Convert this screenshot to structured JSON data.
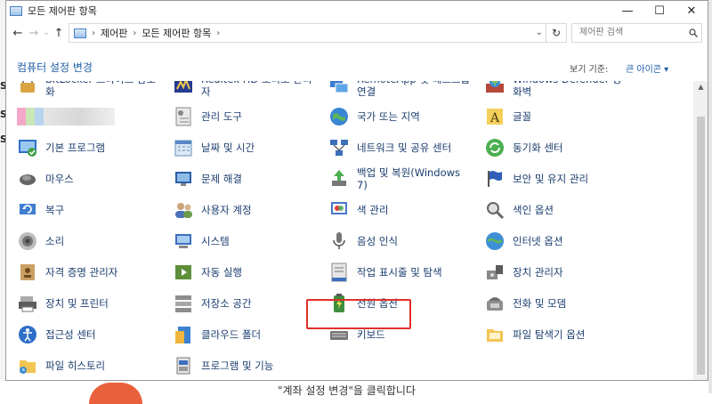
{
  "window": {
    "title": "모든 제어판 항목",
    "controls": {
      "minimize": "—",
      "maximize": "☐",
      "close": "✕"
    }
  },
  "address": {
    "path": [
      "제어판",
      "모든 제어판 항목"
    ],
    "search_placeholder": "제어판 검색"
  },
  "header": {
    "title": "컴퓨터 설정 변경",
    "view_by_label": "보기 기준:",
    "view_by_value": "큰 아이콘 ▾"
  },
  "background": {
    "left_glyphs": [
      "S",
      "S",
      "S"
    ],
    "bottom_text": "\"계좌 설정 변경\"을 클릭합니다"
  },
  "items": [
    {
      "label": "BitLocker 드라이브 암호화",
      "icon": "bitlocker-icon"
    },
    {
      "label": "Realtek HD 오디오 관리자",
      "icon": "realtek-audio-icon"
    },
    {
      "label": "RemoteApp 및 데스크톱 연결",
      "icon": "remoteapp-icon"
    },
    {
      "label": "Windows Defender 방화벽",
      "icon": "firewall-icon"
    },
    {
      "label": "",
      "icon": "blurred-item-icon"
    },
    {
      "label": "관리 도구",
      "icon": "admin-tools-icon"
    },
    {
      "label": "국가 또는 지역",
      "icon": "region-icon"
    },
    {
      "label": "글꼴",
      "icon": "fonts-icon"
    },
    {
      "label": "기본 프로그램",
      "icon": "default-programs-icon"
    },
    {
      "label": "날짜 및 시간",
      "icon": "date-time-icon"
    },
    {
      "label": "네트워크 및 공유 센터",
      "icon": "network-icon"
    },
    {
      "label": "동기화 센터",
      "icon": "sync-center-icon"
    },
    {
      "label": "마우스",
      "icon": "mouse-icon"
    },
    {
      "label": "문제 해결",
      "icon": "troubleshoot-icon"
    },
    {
      "label": "백업 및 복원(Windows 7)",
      "icon": "backup-icon"
    },
    {
      "label": "보안 및 유지 관리",
      "icon": "security-flag-icon"
    },
    {
      "label": "복구",
      "icon": "recovery-icon"
    },
    {
      "label": "사용자 계정",
      "icon": "user-accounts-icon"
    },
    {
      "label": "색 관리",
      "icon": "color-management-icon"
    },
    {
      "label": "색인 옵션",
      "icon": "indexing-icon"
    },
    {
      "label": "소리",
      "icon": "sound-icon"
    },
    {
      "label": "시스템",
      "icon": "system-icon"
    },
    {
      "label": "음성 인식",
      "icon": "speech-icon"
    },
    {
      "label": "인터넷 옵션",
      "icon": "internet-options-icon"
    },
    {
      "label": "자격 증명 관리자",
      "icon": "credential-icon"
    },
    {
      "label": "자동 실행",
      "icon": "autoplay-icon"
    },
    {
      "label": "작업 표시줄 및 탐색",
      "icon": "taskbar-icon"
    },
    {
      "label": "장치 관리자",
      "icon": "device-manager-icon"
    },
    {
      "label": "장치 및 프린터",
      "icon": "devices-printers-icon"
    },
    {
      "label": "저장소 공간",
      "icon": "storage-spaces-icon"
    },
    {
      "label": "전원 옵션",
      "icon": "power-options-icon"
    },
    {
      "label": "전화 및 모뎀",
      "icon": "phone-modem-icon"
    },
    {
      "label": "접근성 센터",
      "icon": "ease-of-access-icon"
    },
    {
      "label": "클라우드 폴더",
      "icon": "cloud-folder-icon"
    },
    {
      "label": "키보드",
      "icon": "keyboard-icon"
    },
    {
      "label": "파일 탐색기 옵션",
      "icon": "folder-options-icon"
    },
    {
      "label": "파일 히스토리",
      "icon": "file-history-icon"
    },
    {
      "label": "프로그램 및 기능",
      "icon": "programs-features-icon"
    }
  ]
}
